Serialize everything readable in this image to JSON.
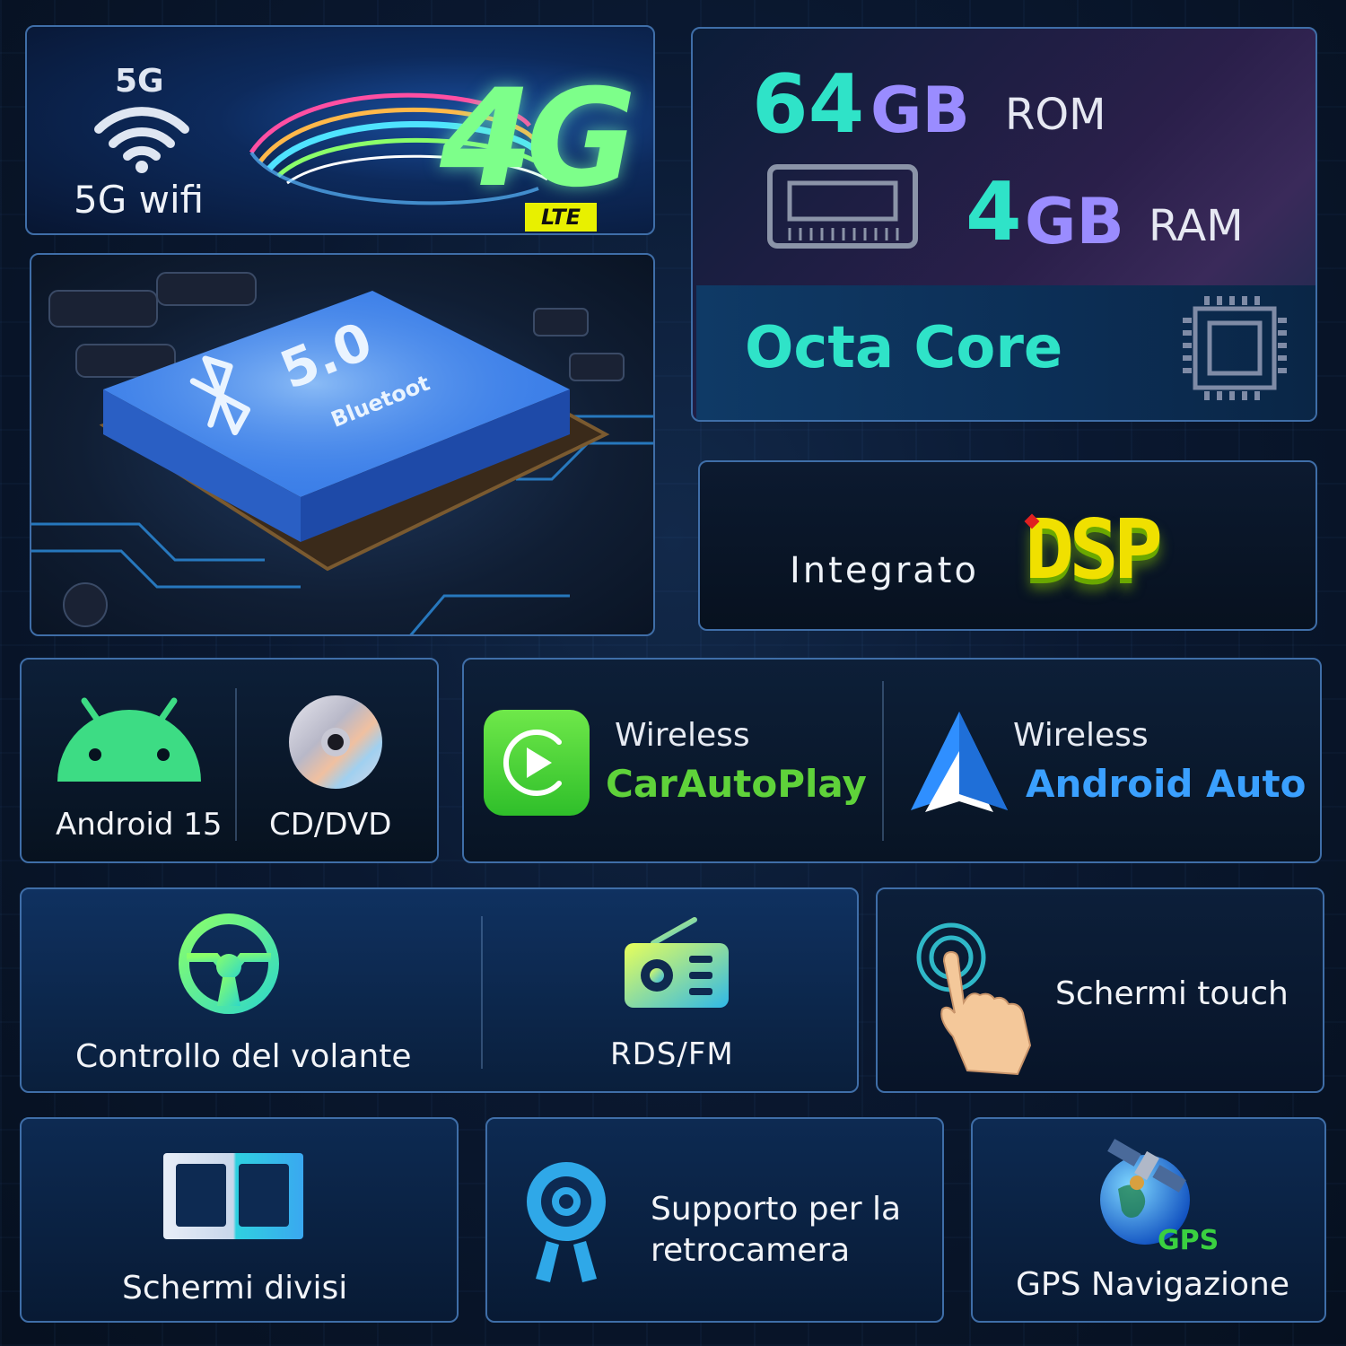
{
  "wifi_card": {
    "badge": "5G",
    "label": "5G wifi",
    "network": "4G",
    "network_sub": "LTE"
  },
  "memory_card": {
    "rom_num": "64",
    "rom_unit": "GB",
    "rom_label": "ROM",
    "ram_num": "4",
    "ram_unit": "GB",
    "ram_label": "RAM",
    "cpu_label": "Octa Core"
  },
  "bluetooth_card": {
    "version": "5.0",
    "name": "Bluetoot"
  },
  "dsp_card": {
    "prefix": "Integrato",
    "logo": "DSP"
  },
  "android_card": {
    "android_label": "Android 15",
    "disc_label": "CD/DVD"
  },
  "carplay_card": {
    "carplay_top": "Wireless",
    "carplay_name": "CarAutoPlay",
    "aa_top": "Wireless",
    "aa_name": "Android Auto"
  },
  "controls_card": {
    "wheel_label": "Controllo del volante",
    "radio_label": "RDS/FM"
  },
  "touch_card": {
    "label": "Schermi touch"
  },
  "split_card": {
    "label": "Schermi divisi"
  },
  "camera_card": {
    "line1": "Supporto per la",
    "line2": "retrocamera"
  },
  "gps_card": {
    "badge": "GPS",
    "label": "GPS Navigazione"
  },
  "colors": {
    "accent_cyan": "#2fe3c8",
    "accent_blue": "#3aa0ff",
    "green": "#5fd23a",
    "android_green": "#3ddc84"
  }
}
